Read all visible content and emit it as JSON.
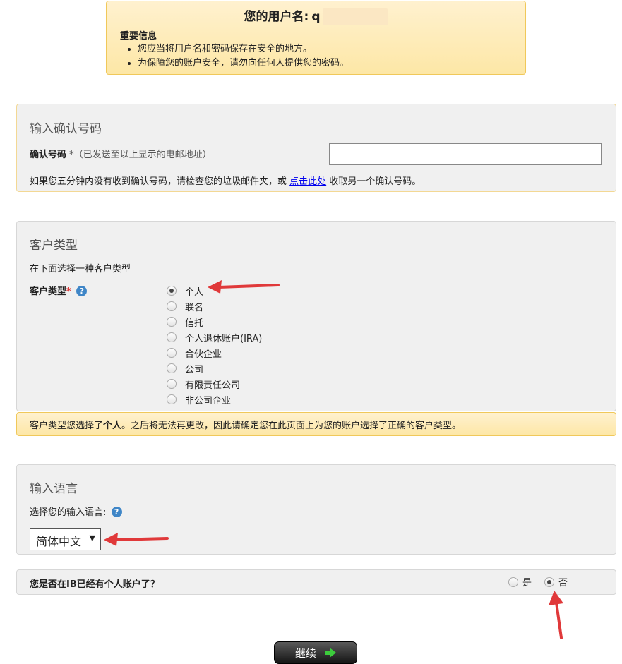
{
  "username_box": {
    "title_prefix": "您的用户名:",
    "username": "q",
    "info_heading": "重要信息",
    "info_items": [
      "您应当将用户名和密码保存在安全的地方。",
      "为保障您的账户安全，请勿向任何人提供您的密码。"
    ]
  },
  "confirmation": {
    "title": "输入确认号码",
    "label": "确认号码",
    "label_hint": "*（已发送至以上显示的电邮地址）",
    "input_value": "",
    "note_before": "如果您五分钟内没有收到确认号码，请检查您的垃圾邮件夹，或 ",
    "note_link": "点击此处",
    "note_after": " 收取另一个确认号码。"
  },
  "customer_type": {
    "title": "客户类型",
    "subtitle": "在下面选择一种客户类型",
    "label": "客户类型",
    "required_mark": "*",
    "help_icon": "?",
    "options": [
      "个人",
      "联名",
      "信托",
      "个人退休账户(IRA)",
      "合伙企业",
      "公司",
      "有限责任公司",
      "非公司企业"
    ],
    "selected": "个人",
    "note_before": "客户类型您选择了",
    "note_selected": "个人",
    "note_after": "。之后将无法再更改，因此请确定您在此页面上为您的账户选择了正确的客户类型。"
  },
  "language": {
    "title": "输入语言",
    "subtitle": "选择您的输入语言:",
    "help_icon": "?",
    "selected": "简体中文"
  },
  "ib_account": {
    "question": "您是否在IB已经有个人账户了？",
    "options": [
      "是",
      "否"
    ],
    "selected": "否"
  },
  "continue_button": {
    "label": "继续",
    "icon": "green-right-arrow-icon"
  },
  "colors": {
    "notice_bg": "#fde7a6",
    "panel_bg": "#f0f0f0",
    "annotation_arrow": "#e0393a",
    "link": "#0000ee"
  }
}
